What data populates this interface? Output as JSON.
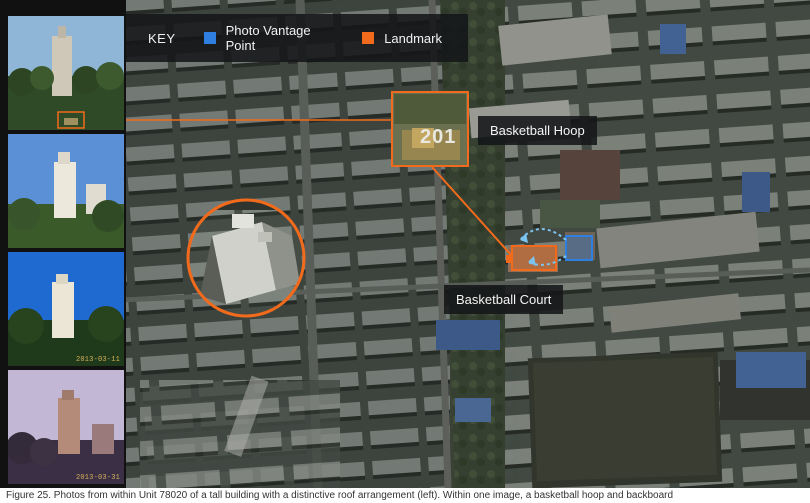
{
  "key": {
    "title": "KEY",
    "entries": [
      {
        "label": "Photo Vantage Point",
        "color": "#2f7fe0"
      },
      {
        "label": "Landmark",
        "color": "#f26b1d"
      }
    ]
  },
  "callouts": {
    "hoop": {
      "label": "Basketball Hoop",
      "inset_text": "201"
    },
    "court": {
      "label": "Basketball Court"
    }
  },
  "thumbnails": [
    {
      "date": ""
    },
    {
      "date": ""
    },
    {
      "date": "2013-03-11"
    },
    {
      "date": "2013-03-31"
    }
  ],
  "caption": "Figure 25. Photos from within Unit 78020 of a tall building with a distinctive roof arrangement (left). Within one image, a basketball hoop and backboard",
  "colors": {
    "accent_orange": "#f26b1d",
    "accent_blue": "#2f7fe0",
    "sight_line": "#7cc4f0"
  }
}
